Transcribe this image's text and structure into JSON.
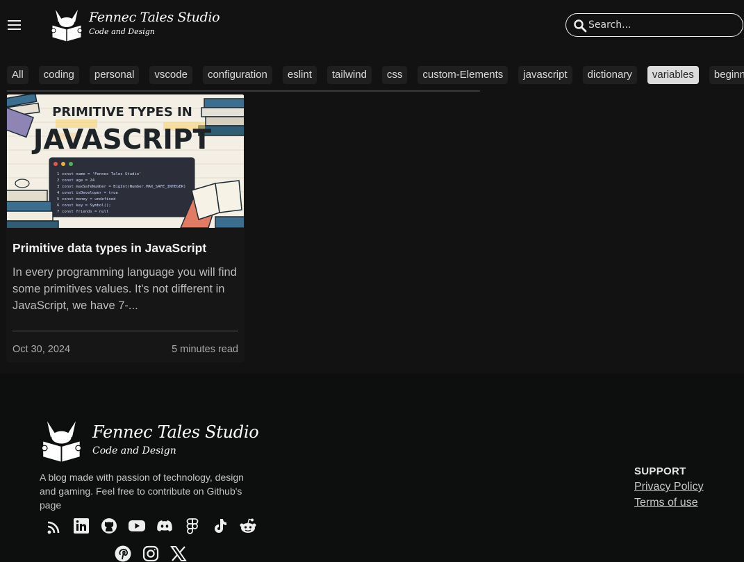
{
  "header": {
    "brand_title": "Fennec Tales Studio",
    "brand_subtitle": "Code and Design",
    "search_placeholder": "Search..."
  },
  "tags": [
    {
      "label": "All",
      "active": false
    },
    {
      "label": "coding",
      "active": false
    },
    {
      "label": "personal",
      "active": false
    },
    {
      "label": "vscode",
      "active": false
    },
    {
      "label": "configuration",
      "active": false
    },
    {
      "label": "eslint",
      "active": false
    },
    {
      "label": "tailwind",
      "active": false
    },
    {
      "label": "css",
      "active": false
    },
    {
      "label": "custom-Elements",
      "active": false
    },
    {
      "label": "javascript",
      "active": false
    },
    {
      "label": "dictionary",
      "active": false
    },
    {
      "label": "variables",
      "active": true
    },
    {
      "label": "beginners",
      "active": false
    }
  ],
  "posts": [
    {
      "image": {
        "heading_line1": "PRIMITIVE TYPES IN",
        "heading_line2": "JAVASCRIPT",
        "code_lines": [
          "const name = 'Fennec Tales Studio'",
          "const age = 24",
          "const maxSafeNumber = BigInt(Number.MAX_SAFE_INTEGER)",
          "const isDeveloper = true",
          "const money = undefined",
          "const key = Symbol();",
          "const friends = null"
        ]
      },
      "title": "Primitive data types in JavaScript",
      "excerpt": "In every programming language you will find some primitives values. It's not different in JavaScript, we have 7-...",
      "date": "Oct 30, 2024",
      "read_time": "5 minutes read"
    }
  ],
  "footer": {
    "brand_title": "Fennec Tales Studio",
    "brand_subtitle": "Code and Design",
    "description": "A blog made with passion of technology, design and gaming. Feel free to contribute on Github's page",
    "social_icons": [
      "rss-icon",
      "linkedin-icon",
      "github-icon",
      "youtube-icon",
      "discord-icon",
      "figma-icon",
      "tiktok-icon",
      "reddit-icon",
      "pinterest-icon",
      "instagram-icon",
      "x-icon"
    ],
    "support": {
      "title": "SUPPORT",
      "links": [
        "Privacy Policy",
        "Terms of use"
      ]
    }
  },
  "colors": {
    "background": "#121212",
    "footer_background": "#0d0f0f",
    "active_tag": "#dcdcdc"
  }
}
